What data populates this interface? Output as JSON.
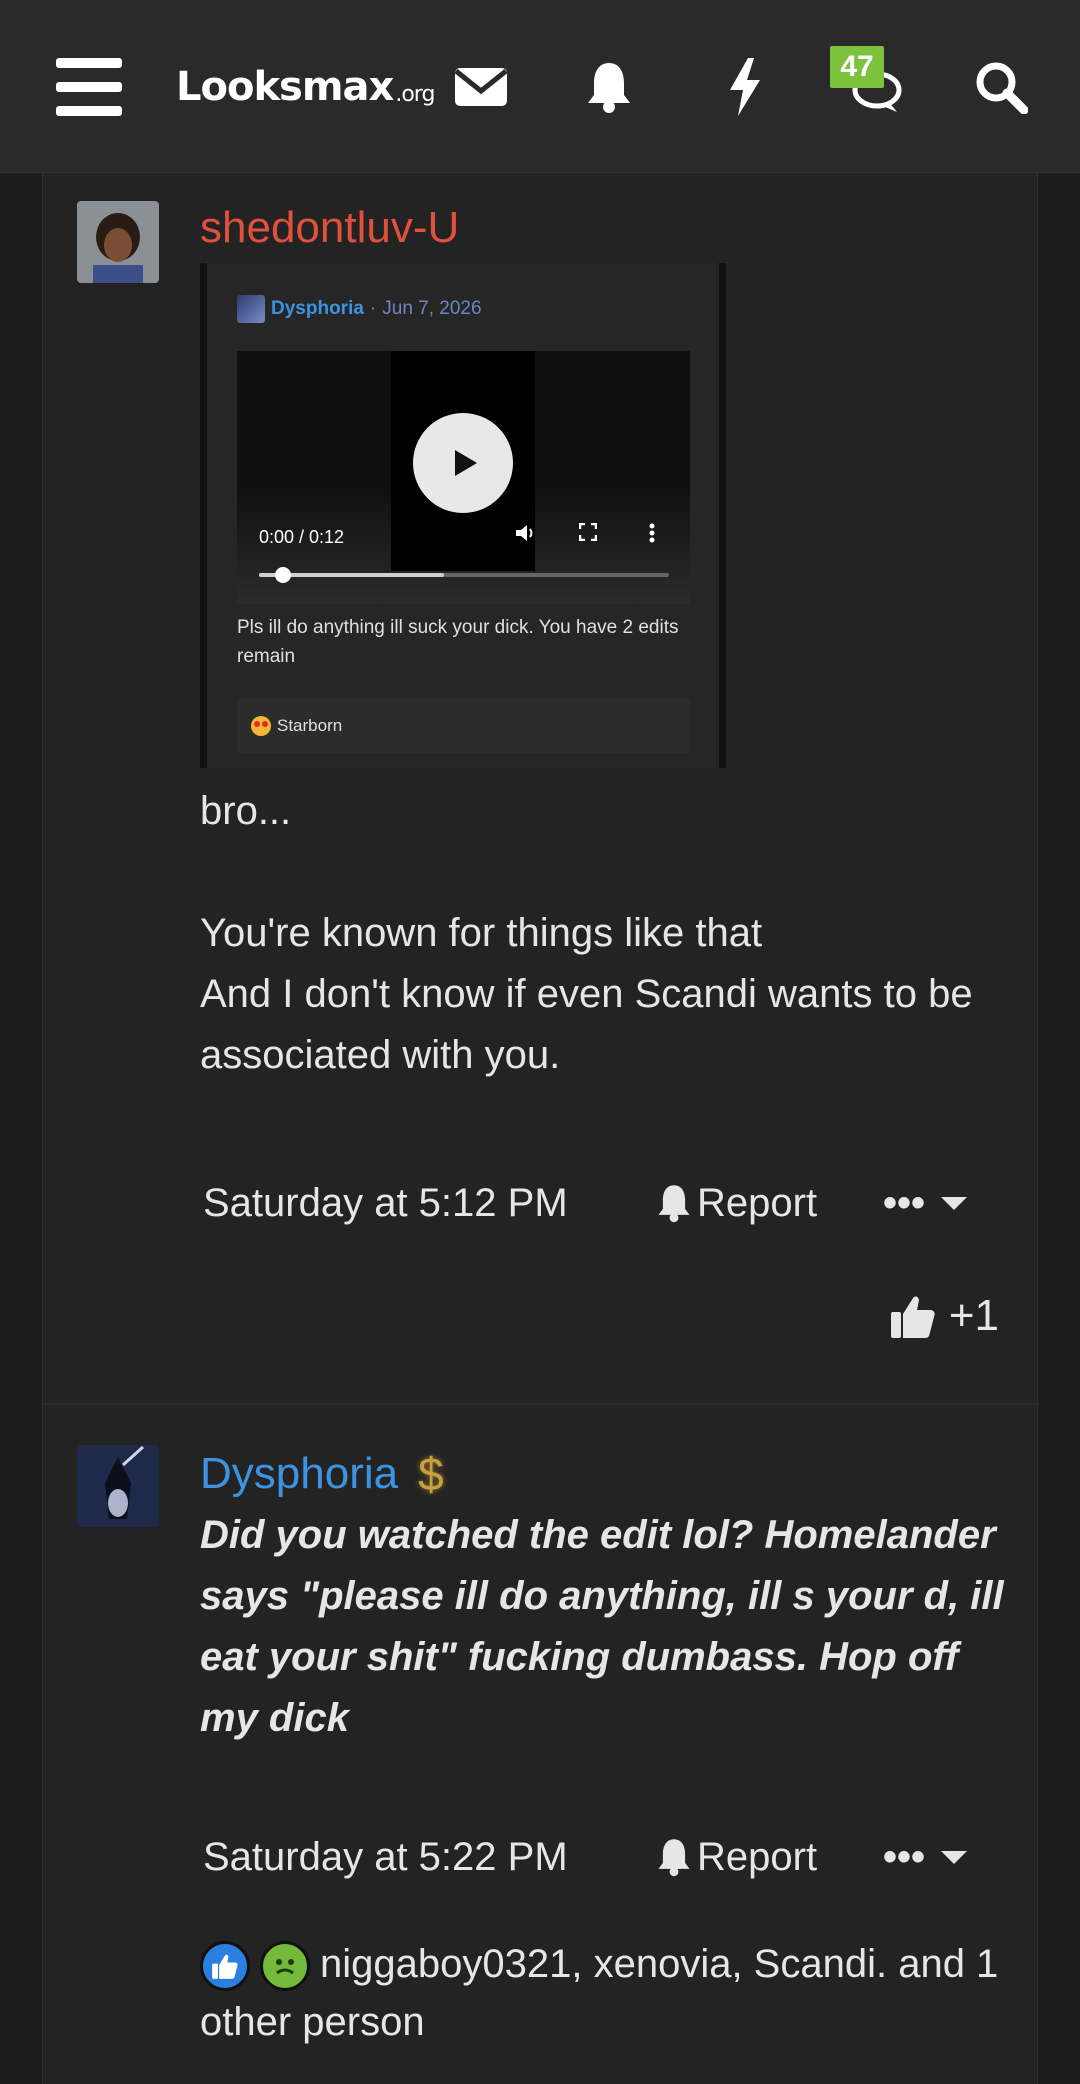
{
  "header": {
    "logo": "Looksmax",
    "logo_suffix": ".org",
    "chat_badge": "47"
  },
  "post1": {
    "username": "shedontluv-U",
    "quote": {
      "author": "Dysphoria",
      "separator": "·",
      "date": "Jun 7, 2026",
      "video_time": "0:00 / 0:12",
      "video_progress": 0.45,
      "text": "Pls ill do anything ill suck your dick. You have 2 edits remain",
      "reaction": "Starborn"
    },
    "body_line1": "bro...",
    "body_line2": "You're known for things like that",
    "body_line3": "And I don't know if even Scandi wants to be associated with you.",
    "time": "Saturday at 5:12 PM",
    "report": "Report",
    "more": "•••",
    "like_count": "+1"
  },
  "post2": {
    "username": "Dysphoria",
    "badge_symbol": "$",
    "body": "Did you watched the edit lol? Homelander says \"please ill do anything, ill s your d, ill eat your shit\" fucking dumbass. Hop off my dick",
    "time": "Saturday at 5:22 PM",
    "report": "Report",
    "more": "•••",
    "reactions_text": "niggaboy0321, xenovia, Scandi. and 1 other person"
  },
  "colors": {
    "username_red": "#e0503c",
    "username_blue": "#3d93e0",
    "badge_green": "#7dc23c"
  }
}
